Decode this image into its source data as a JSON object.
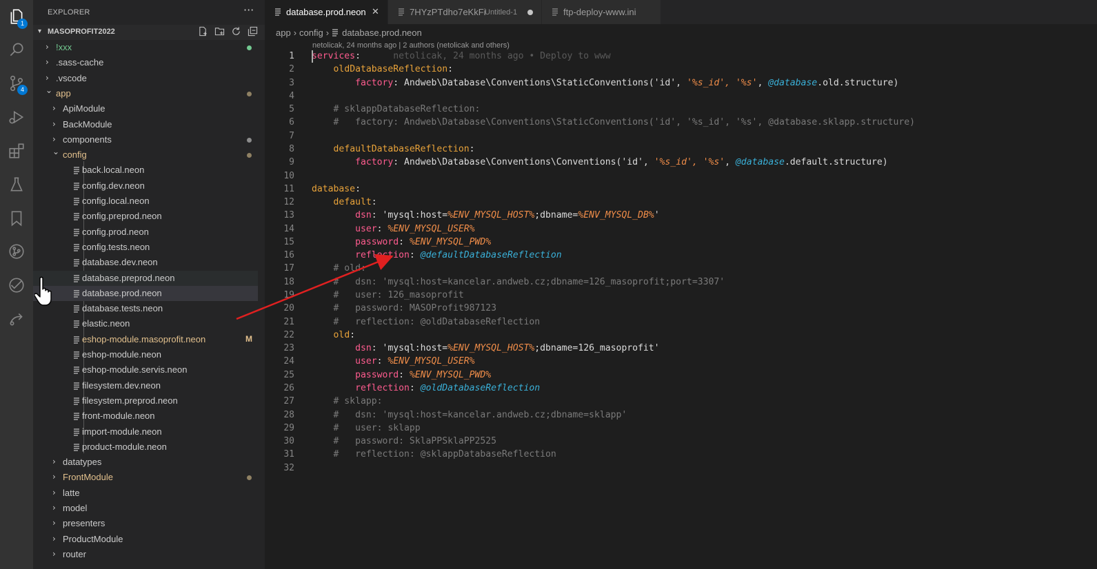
{
  "activity_bar": {
    "items": [
      {
        "name": "explorer",
        "badge": "1"
      },
      {
        "name": "search",
        "badge": ""
      },
      {
        "name": "source-control",
        "badge": "4"
      },
      {
        "name": "run-debug",
        "badge": ""
      },
      {
        "name": "extensions",
        "badge": ""
      },
      {
        "name": "testing",
        "badge": ""
      },
      {
        "name": "bookmarks",
        "badge": ""
      },
      {
        "name": "git-graph",
        "badge": ""
      },
      {
        "name": "deploy",
        "badge": ""
      },
      {
        "name": "remote",
        "badge": ""
      }
    ]
  },
  "sidebar": {
    "title": "EXPLORER",
    "more": "···",
    "workspace": "MASOPROFIT2022",
    "tree": [
      {
        "label": "!xxx",
        "type": "folder",
        "depth": 0,
        "expanded": false,
        "color": "#73c991",
        "dot": "#73c991"
      },
      {
        "label": ".sass-cache",
        "type": "folder",
        "depth": 0,
        "expanded": false
      },
      {
        "label": ".vscode",
        "type": "folder",
        "depth": 0,
        "expanded": false
      },
      {
        "label": "app",
        "type": "folder",
        "depth": 0,
        "expanded": true,
        "color": "#e2c08d",
        "dot": "#8f8163"
      },
      {
        "label": "ApiModule",
        "type": "folder",
        "depth": 1,
        "expanded": false
      },
      {
        "label": "BackModule",
        "type": "folder",
        "depth": 1,
        "expanded": false
      },
      {
        "label": "components",
        "type": "folder",
        "depth": 1,
        "expanded": false,
        "dot": "#8c8c8c"
      },
      {
        "label": "config",
        "type": "folder",
        "depth": 1,
        "expanded": true,
        "color": "#e2c08d",
        "dot": "#8f8163"
      },
      {
        "label": "back.local.neon",
        "type": "file",
        "depth": 2
      },
      {
        "label": "config.dev.neon",
        "type": "file",
        "depth": 2
      },
      {
        "label": "config.local.neon",
        "type": "file",
        "depth": 2
      },
      {
        "label": "config.preprod.neon",
        "type": "file",
        "depth": 2
      },
      {
        "label": "config.prod.neon",
        "type": "file",
        "depth": 2
      },
      {
        "label": "config.tests.neon",
        "type": "file",
        "depth": 2
      },
      {
        "label": "database.dev.neon",
        "type": "file",
        "depth": 2
      },
      {
        "label": "database.preprod.neon",
        "type": "file",
        "depth": 2,
        "state": "hover"
      },
      {
        "label": "database.prod.neon",
        "type": "file",
        "depth": 2,
        "state": "selected"
      },
      {
        "label": "database.tests.neon",
        "type": "file",
        "depth": 2
      },
      {
        "label": "elastic.neon",
        "type": "file",
        "depth": 2
      },
      {
        "label": "eshop-module.masoprofit.neon",
        "type": "file",
        "depth": 2,
        "color": "#e2c08d",
        "badge": "M"
      },
      {
        "label": "eshop-module.neon",
        "type": "file",
        "depth": 2
      },
      {
        "label": "eshop-module.servis.neon",
        "type": "file",
        "depth": 2
      },
      {
        "label": "filesystem.dev.neon",
        "type": "file",
        "depth": 2
      },
      {
        "label": "filesystem.preprod.neon",
        "type": "file",
        "depth": 2
      },
      {
        "label": "front-module.neon",
        "type": "file",
        "depth": 2
      },
      {
        "label": "import-module.neon",
        "type": "file",
        "depth": 2
      },
      {
        "label": "product-module.neon",
        "type": "file",
        "depth": 2
      },
      {
        "label": "datatypes",
        "type": "folder",
        "depth": 1,
        "expanded": false
      },
      {
        "label": "FrontModule",
        "type": "folder",
        "depth": 1,
        "expanded": false,
        "color": "#e2c08d",
        "dot": "#8f8163"
      },
      {
        "label": "latte",
        "type": "folder",
        "depth": 1,
        "expanded": false
      },
      {
        "label": "model",
        "type": "folder",
        "depth": 1,
        "expanded": false
      },
      {
        "label": "presenters",
        "type": "folder",
        "depth": 1,
        "expanded": false
      },
      {
        "label": "ProductModule",
        "type": "folder",
        "depth": 1,
        "expanded": false
      },
      {
        "label": "router",
        "type": "folder",
        "depth": 1,
        "expanded": false
      }
    ]
  },
  "tabs": [
    {
      "label": "database.prod.neon",
      "description": "",
      "active": true,
      "close": "✕"
    },
    {
      "label": "7HYzPTdho7eKkFi",
      "description": "Untitled-1",
      "active": false,
      "dirty": true
    },
    {
      "label": "ftp-deploy-www.ini",
      "description": "",
      "active": false
    }
  ],
  "breadcrumb": [
    "app",
    "config",
    "database.prod.neon"
  ],
  "editor": {
    "codelens": "netolicak, 24 months ago | 2 authors (netolicak and others)",
    "current_line": 1,
    "lines": [
      {
        "n": "1",
        "t": [
          [
            "k",
            "services"
          ],
          [
            "w",
            ":"
          ],
          [
            "blame",
            "      netolicak, 24 months ago • Deploy to www"
          ]
        ]
      },
      {
        "n": "2",
        "t": [
          [
            "w",
            "    "
          ],
          [
            "k2",
            "oldDatabaseReflection"
          ],
          [
            "w",
            ":"
          ]
        ]
      },
      {
        "n": "3",
        "t": [
          [
            "w",
            "        "
          ],
          [
            "k",
            "factory"
          ],
          [
            "w",
            ": Andweb\\Database\\Conventions\\StaticConventions('id', "
          ],
          [
            "v",
            "'%s_id', '%s'"
          ],
          [
            "w",
            ", "
          ],
          [
            "r",
            "@database"
          ],
          [
            "w",
            ".old.structure)"
          ]
        ]
      },
      {
        "n": "4",
        "t": []
      },
      {
        "n": "5",
        "t": [
          [
            "c",
            "    # sklappDatabaseReflection:"
          ]
        ]
      },
      {
        "n": "6",
        "t": [
          [
            "c",
            "    #   factory: Andweb\\Database\\Conventions\\StaticConventions('id', '%s_id', '%s', @database.sklapp.structure)"
          ]
        ]
      },
      {
        "n": "7",
        "t": []
      },
      {
        "n": "8",
        "t": [
          [
            "w",
            "    "
          ],
          [
            "k2",
            "defaultDatabaseReflection"
          ],
          [
            "w",
            ":"
          ]
        ]
      },
      {
        "n": "9",
        "t": [
          [
            "w",
            "        "
          ],
          [
            "k",
            "factory"
          ],
          [
            "w",
            ": Andweb\\Database\\Conventions\\Conventions('id', "
          ],
          [
            "v",
            "'%s_id', '%s'"
          ],
          [
            "w",
            ", "
          ],
          [
            "r",
            "@database"
          ],
          [
            "w",
            ".default.structure)"
          ]
        ]
      },
      {
        "n": "10",
        "t": []
      },
      {
        "n": "11",
        "t": [
          [
            "k2",
            "database"
          ],
          [
            "w",
            ":"
          ]
        ]
      },
      {
        "n": "12",
        "t": [
          [
            "w",
            "    "
          ],
          [
            "k2",
            "default"
          ],
          [
            "w",
            ":"
          ]
        ]
      },
      {
        "n": "13",
        "t": [
          [
            "w",
            "        "
          ],
          [
            "k",
            "dsn"
          ],
          [
            "w",
            ": 'mysql:host="
          ],
          [
            "v",
            "%ENV_MYSQL_HOST%"
          ],
          [
            "w",
            ";dbname="
          ],
          [
            "v",
            "%ENV_MYSQL_DB%"
          ],
          [
            "w",
            "'"
          ]
        ]
      },
      {
        "n": "14",
        "t": [
          [
            "w",
            "        "
          ],
          [
            "k",
            "user"
          ],
          [
            "w",
            ": "
          ],
          [
            "v",
            "%ENV_MYSQL_USER%"
          ]
        ]
      },
      {
        "n": "15",
        "t": [
          [
            "w",
            "        "
          ],
          [
            "k",
            "password"
          ],
          [
            "w",
            ": "
          ],
          [
            "v",
            "%ENV_MYSQL_PWD%"
          ]
        ]
      },
      {
        "n": "16",
        "t": [
          [
            "w",
            "        "
          ],
          [
            "k",
            "reflection"
          ],
          [
            "w",
            ": "
          ],
          [
            "r",
            "@defaultDatabaseReflection"
          ]
        ]
      },
      {
        "n": "17",
        "t": [
          [
            "c",
            "    # old:"
          ]
        ]
      },
      {
        "n": "18",
        "t": [
          [
            "c",
            "    #   dsn: 'mysql:host=kancelar.andweb.cz;dbname=126_masoprofit;port=3307'"
          ]
        ]
      },
      {
        "n": "19",
        "t": [
          [
            "c",
            "    #   user: 126_masoprofit"
          ]
        ]
      },
      {
        "n": "20",
        "t": [
          [
            "c",
            "    #   password: MASOProfit987123"
          ]
        ]
      },
      {
        "n": "21",
        "t": [
          [
            "c",
            "    #   reflection: @oldDatabaseReflection"
          ]
        ]
      },
      {
        "n": "22",
        "t": [
          [
            "w",
            "    "
          ],
          [
            "k2",
            "old"
          ],
          [
            "w",
            ":"
          ]
        ]
      },
      {
        "n": "23",
        "t": [
          [
            "w",
            "        "
          ],
          [
            "k",
            "dsn"
          ],
          [
            "w",
            ": 'mysql:host="
          ],
          [
            "v",
            "%ENV_MYSQL_HOST%"
          ],
          [
            "w",
            ";dbname=126_masoprofit'"
          ]
        ]
      },
      {
        "n": "24",
        "t": [
          [
            "w",
            "        "
          ],
          [
            "k",
            "user"
          ],
          [
            "w",
            ": "
          ],
          [
            "v",
            "%ENV_MYSQL_USER%"
          ]
        ]
      },
      {
        "n": "25",
        "t": [
          [
            "w",
            "        "
          ],
          [
            "k",
            "password"
          ],
          [
            "w",
            ": "
          ],
          [
            "v",
            "%ENV_MYSQL_PWD%"
          ]
        ]
      },
      {
        "n": "26",
        "t": [
          [
            "w",
            "        "
          ],
          [
            "k",
            "reflection"
          ],
          [
            "w",
            ": "
          ],
          [
            "r",
            "@oldDatabaseReflection"
          ]
        ]
      },
      {
        "n": "27",
        "t": [
          [
            "c",
            "    # sklapp:"
          ]
        ]
      },
      {
        "n": "28",
        "t": [
          [
            "c",
            "    #   dsn: 'mysql:host=kancelar.andweb.cz;dbname=sklapp'"
          ]
        ]
      },
      {
        "n": "29",
        "t": [
          [
            "c",
            "    #   user: sklapp"
          ]
        ]
      },
      {
        "n": "30",
        "t": [
          [
            "c",
            "    #   password: SklaPPSklaPP2525"
          ]
        ]
      },
      {
        "n": "31",
        "t": [
          [
            "c",
            "    #   reflection: @sklappDatabaseReflection"
          ]
        ]
      },
      {
        "n": "32",
        "t": []
      }
    ]
  },
  "annotation": {
    "arrow_color": "#e02020"
  },
  "colors": {
    "activity_bar": "#333333",
    "sidebar": "#252526",
    "editor": "#1e1e1e",
    "accent": "#0078d4"
  }
}
